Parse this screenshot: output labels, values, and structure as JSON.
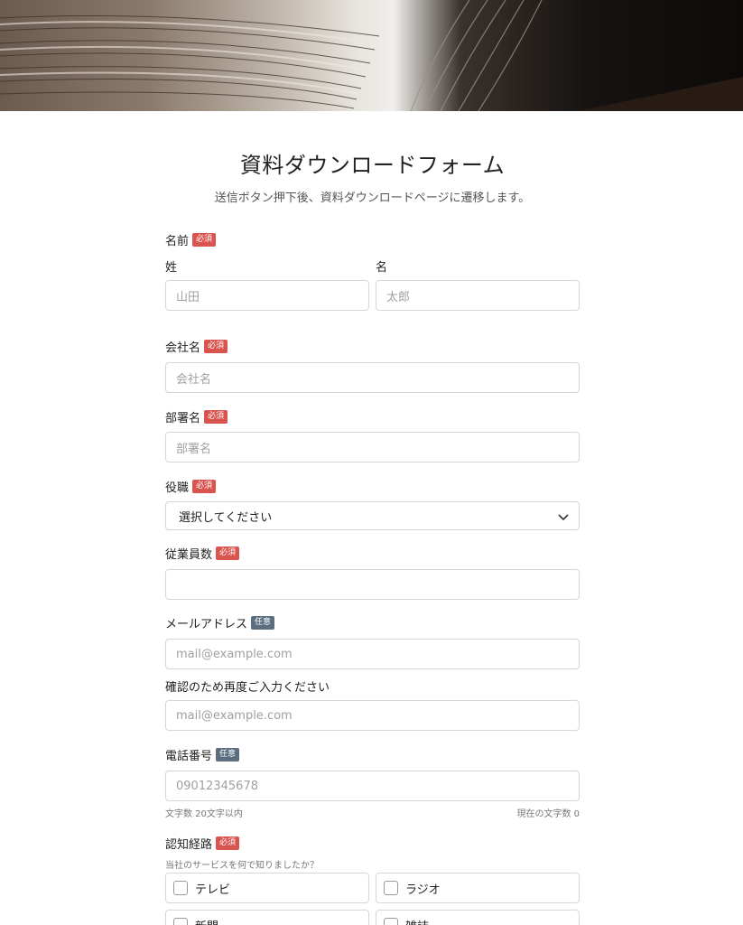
{
  "form": {
    "title": "資料ダウンロードフォーム",
    "subtitle": "送信ボタン押下後、資料ダウンロードページに遷移します。",
    "badges": {
      "required": "必須",
      "optional": "任意"
    },
    "name": {
      "label": "名前",
      "last_label": "姓",
      "first_label": "名",
      "last_placeholder": "山田",
      "first_placeholder": "太郎"
    },
    "company": {
      "label": "会社名",
      "placeholder": "会社名"
    },
    "department": {
      "label": "部署名",
      "placeholder": "部署名"
    },
    "position": {
      "label": "役職",
      "selected": "選択してください"
    },
    "employees": {
      "label": "従業員数",
      "placeholder": ""
    },
    "email": {
      "label": "メールアドレス",
      "placeholder": "mail@example.com"
    },
    "email_confirm": {
      "label": "確認のため再度ご入力ください",
      "placeholder": "mail@example.com"
    },
    "phone": {
      "label": "電話番号",
      "placeholder": "09012345678",
      "hint_limit": "文字数 20文字以内",
      "hint_count": "現在の文字数 0"
    },
    "source": {
      "label": "認知経路",
      "help": "当社のサービスを何で知りましたか？",
      "options": [
        "テレビ",
        "ラジオ",
        "新聞",
        "雑誌"
      ]
    }
  },
  "colors": {
    "required_badge": "#d9534f",
    "optional_badge": "#5a6e80",
    "border": "#d6d6d6"
  }
}
